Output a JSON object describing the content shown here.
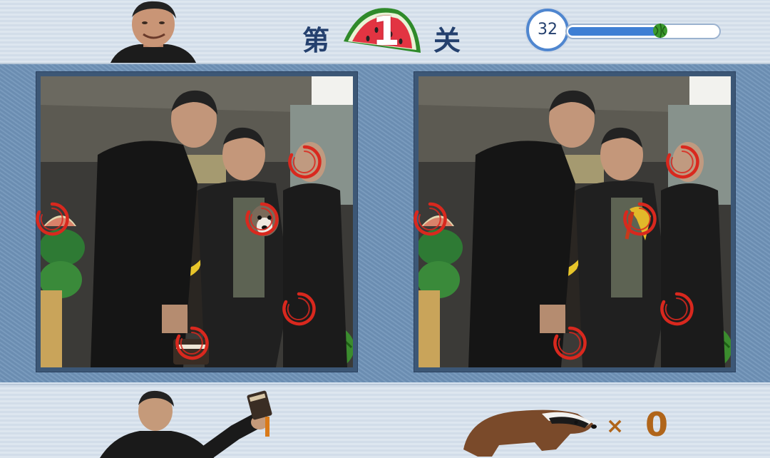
{
  "header": {
    "level_prefix": "第",
    "level_number": "1",
    "level_suffix": "关",
    "timer_value": "32",
    "time_progress": 0.6
  },
  "scenes": {
    "left": {
      "markers": [
        {
          "name": "marker-watermelon-slice"
        },
        {
          "name": "marker-man-face"
        },
        {
          "name": "marker-dog-face"
        },
        {
          "name": "marker-hand"
        },
        {
          "name": "marker-cigarette-box"
        }
      ]
    },
    "right": {
      "markers": [
        {
          "name": "marker-watermelon-slice"
        },
        {
          "name": "marker-man-face"
        },
        {
          "name": "marker-banana-peel"
        },
        {
          "name": "marker-hand"
        },
        {
          "name": "marker-empty"
        }
      ]
    }
  },
  "footer": {
    "multiply_sign": "×",
    "badger_count": "0"
  },
  "colors": {
    "accent_blue": "#4f86cf",
    "title_navy": "#24406e",
    "marker_red": "#d9281e",
    "count_orange": "#b0651a"
  }
}
